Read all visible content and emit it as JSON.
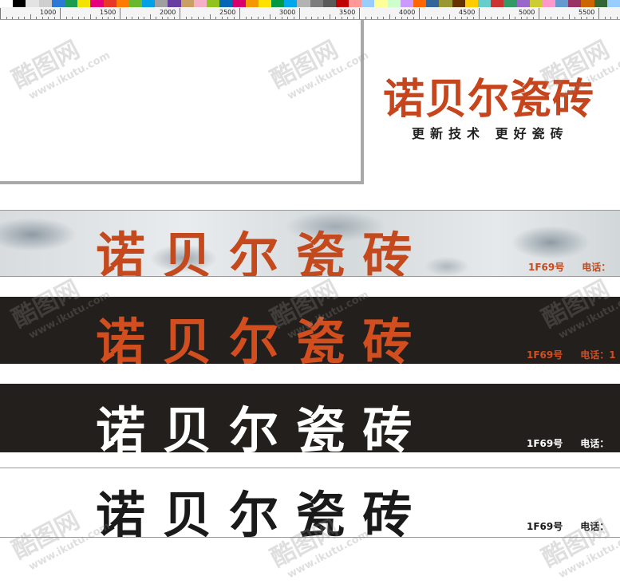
{
  "palette_colors": [
    "#ffffff",
    "#000000",
    "#e3e3e3",
    "#cfcfcf",
    "#2c7ad6",
    "#1b9c4e",
    "#f2e400",
    "#e5007e",
    "#e73828",
    "#ff7a00",
    "#68b92e",
    "#00a0e9",
    "#a0a0a0",
    "#6a3ea0",
    "#c9a063",
    "#f5b0c7",
    "#8fc31f",
    "#0068b7",
    "#d7006c",
    "#f39800",
    "#ffe100",
    "#009944",
    "#00a7ea",
    "#b3b3b3",
    "#7d7d7d",
    "#5a5a5a",
    "#c00000",
    "#ff9999",
    "#99ccff",
    "#ffff99",
    "#ccffcc",
    "#cc99ff",
    "#ff6600",
    "#336699",
    "#999933",
    "#663300",
    "#ffcc00",
    "#66cccc",
    "#cc3333",
    "#339966",
    "#9966cc",
    "#cccc33",
    "#ff99cc",
    "#6699cc",
    "#993366",
    "#cc6600",
    "#336633",
    "#99ccff"
  ],
  "ruler": {
    "labels": [
      "1000",
      "1500",
      "2000",
      "2500",
      "3000",
      "3500",
      "4000",
      "4500",
      "5000",
      "5500"
    ]
  },
  "logo": {
    "title": "诺贝尔瓷砖",
    "subtitle": "更新技术  更好瓷砖",
    "color": "#c7451c"
  },
  "signs": [
    {
      "name": "诺 贝 尔 瓷 砖",
      "info_id": "1F69号",
      "info_tel": "电话：",
      "name_color": "#c44a1d",
      "info_color": "#c44a1d",
      "background": "marble"
    },
    {
      "name": "诺 贝 尔 瓷 砖",
      "info_id": "1F69号",
      "info_tel": "电话：1",
      "name_color": "#d24e1f",
      "info_color": "#d24e1f",
      "background": "#231f1c"
    },
    {
      "name": "诺 贝 尔 瓷 砖",
      "info_id": "1F69号",
      "info_tel": "电话：",
      "name_color": "#ffffff",
      "info_color": "#ffffff",
      "background": "#231f1c"
    },
    {
      "name": "诺 贝 尔 瓷 砖",
      "info_id": "1F69号",
      "info_tel": "电话：",
      "name_color": "#1a1a1a",
      "info_color": "#1a1a1a",
      "background": "#ffffff"
    }
  ],
  "watermark": {
    "brand": "酷图网",
    "url": "www.ikutu.com"
  }
}
